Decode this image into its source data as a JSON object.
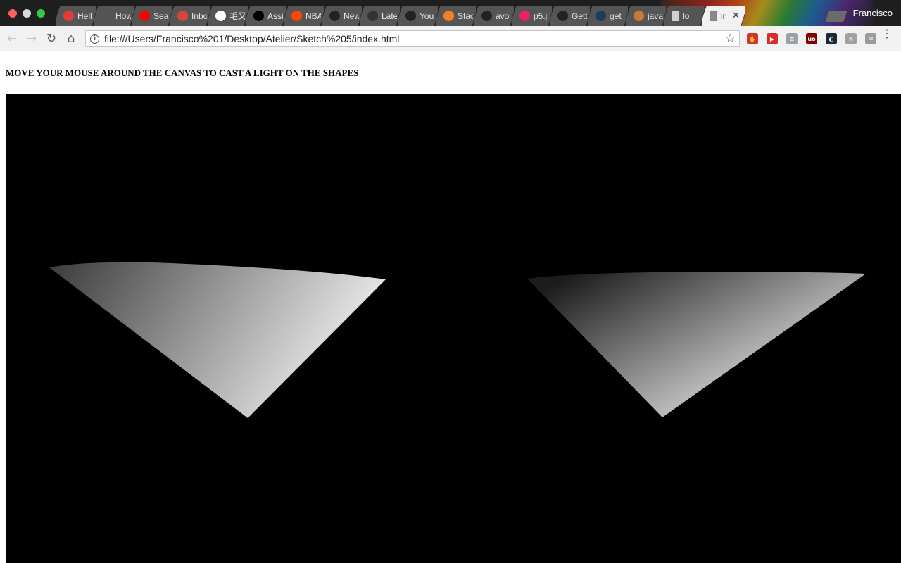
{
  "browser": {
    "tabs": [
      {
        "label": "Hell",
        "icon": "opera-icon",
        "color": "#e23b3b"
      },
      {
        "label": "How",
        "icon": "smile-icon",
        "color": "#555555"
      },
      {
        "label": "Sea",
        "icon": "youtube-icon",
        "color": "#ff0000"
      },
      {
        "label": "Inbo",
        "icon": "gmail-icon",
        "color": "#d44638"
      },
      {
        "label": "毛又",
        "icon": "google-icon",
        "color": "#ffffff"
      },
      {
        "label": "Assi",
        "icon": "assignment-icon",
        "color": "#000000"
      },
      {
        "label": "NBA",
        "icon": "reddit-icon",
        "color": "#ff4500"
      },
      {
        "label": "New",
        "icon": "circle-dot-icon",
        "color": "#222222"
      },
      {
        "label": "Late",
        "icon": "q-icon",
        "color": "#333333"
      },
      {
        "label": "You",
        "icon": "github-icon",
        "color": "#222222"
      },
      {
        "label": "Stac",
        "icon": "stackoverflow-icon",
        "color": "#f48024"
      },
      {
        "label": "avo",
        "icon": "github-icon",
        "color": "#222222"
      },
      {
        "label": "p5.j",
        "icon": "p5-star-icon",
        "color": "#ed225d"
      },
      {
        "label": "Gett",
        "icon": "github-icon",
        "color": "#222222"
      },
      {
        "label": "get",
        "icon": "p-icon",
        "color": "#1e3a5f"
      },
      {
        "label": "java",
        "icon": "pencil-icon",
        "color": "#c87a3a"
      },
      {
        "label": "lo",
        "icon": "file-icon",
        "color": "#cfcfcf"
      },
      {
        "label": "ir",
        "icon": "file-icon",
        "color": "#888888",
        "active": true,
        "close": "✕"
      }
    ],
    "profile": "Francisco",
    "nav": {
      "back": "←",
      "forward": "→",
      "reload": "↻",
      "home": "⌂"
    },
    "address": {
      "info": "i",
      "url": "file:///Users/Francisco%201/Desktop/Atelier/Sketch%205/index.html",
      "star": "☆"
    },
    "extensions": [
      {
        "name": "adblock-icon",
        "color": "#d0342c",
        "glyph": "✋"
      },
      {
        "name": "ext-red-play-icon",
        "color": "#d62e2e",
        "glyph": "▶"
      },
      {
        "name": "ext-reader-icon",
        "color": "#9aa0a6",
        "glyph": "≡"
      },
      {
        "name": "ublock-icon",
        "color": "#800000",
        "glyph": "uo"
      },
      {
        "name": "ext-dark-icon",
        "color": "#1b2838",
        "glyph": "◐"
      },
      {
        "name": "ext-h-icon",
        "color": "#a0a0a0",
        "glyph": "h"
      },
      {
        "name": "ext-mail-icon",
        "color": "#9a9a9a",
        "glyph": "✉"
      }
    ],
    "menu": "⋮"
  },
  "page": {
    "instructions": "MOVE YOUR MOUSE AROUND THE CANVAS TO CAST A LIGHT ON THE SHAPES",
    "canvas_background": "#000000",
    "shapes": [
      {
        "name": "left-cone",
        "light": "#eeeeee",
        "dark": "#3a3a3a"
      },
      {
        "name": "right-cone",
        "light": "#f2f2f2",
        "dark": "#1c1c1c"
      }
    ]
  }
}
